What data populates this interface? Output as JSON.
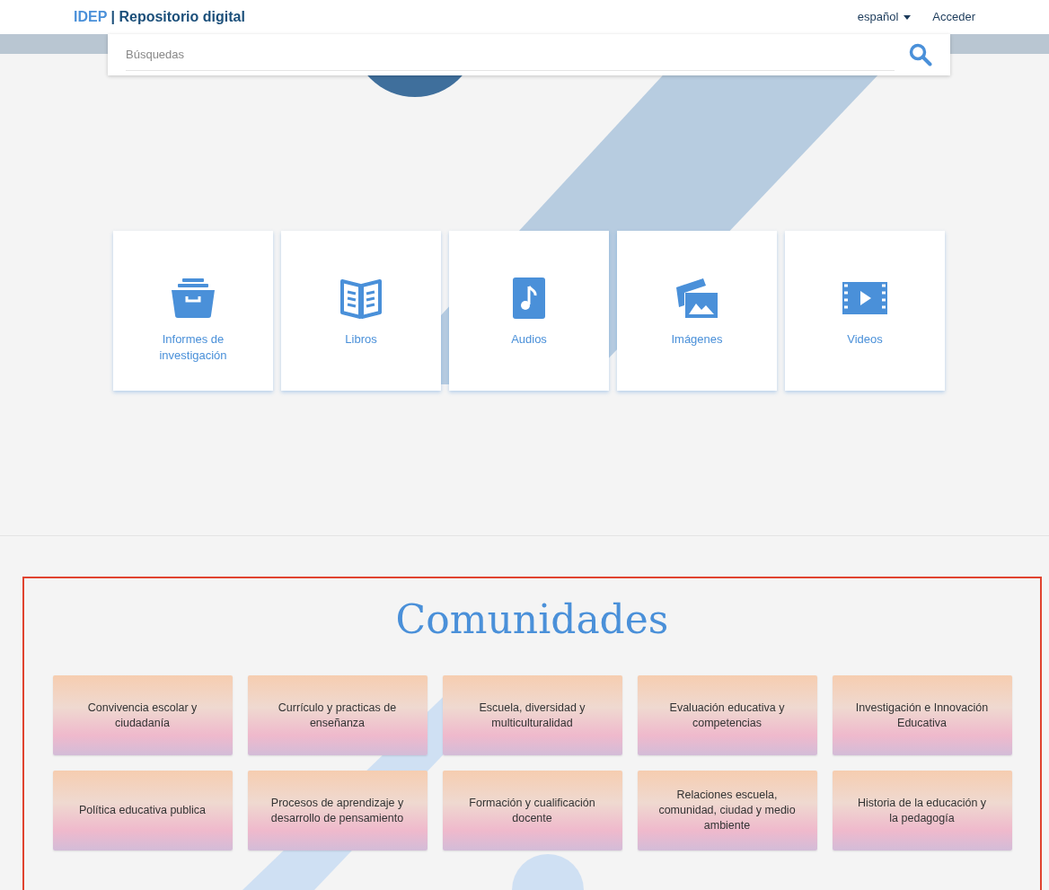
{
  "header": {
    "brand": "IDEP",
    "separator": "|",
    "title": "Repositorio digital",
    "language": "español",
    "login": "Acceder"
  },
  "search": {
    "placeholder": "Búsquedas"
  },
  "categories": [
    {
      "kind": "archive",
      "label": "Informes de investigación"
    },
    {
      "kind": "book",
      "label": "Libros"
    },
    {
      "kind": "music",
      "label": "Audios"
    },
    {
      "kind": "images",
      "label": "Imágenes"
    },
    {
      "kind": "video",
      "label": "Videos"
    }
  ],
  "communities": {
    "title": "Comunidades",
    "items": [
      "Convivencia escolar y ciudadanía",
      "Currículo y practicas de enseñanza",
      "Escuela, diversidad y multiculturalidad",
      "Evaluación educativa y competencias",
      "Investigación e Innovación Educativa",
      "Política educativa publica",
      "Procesos de aprendizaje y desarrollo de pensamiento",
      "Formación y cualificación docente",
      "Relaciones escuela, comunidad, ciudad y medio ambiente",
      "Historia de la educación y la pedagogía"
    ]
  }
}
